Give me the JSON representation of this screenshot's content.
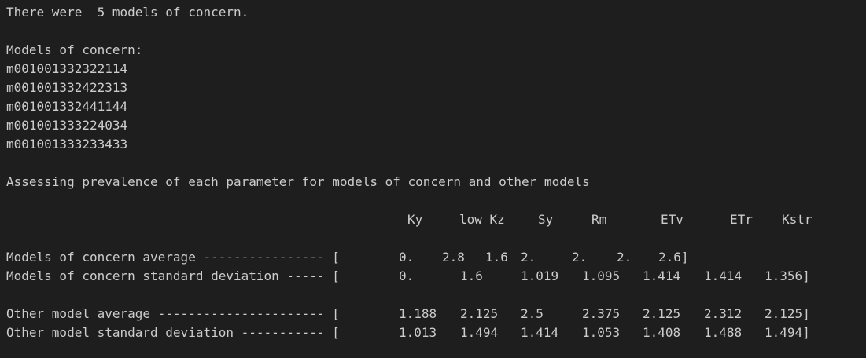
{
  "output": {
    "summary": "There were  5 models of concern.",
    "models_heading": "Models of concern:",
    "models": [
      "m001001332322114",
      "m001001332422313",
      "m001001332441144",
      "m001001333224034",
      "m001001333233433"
    ],
    "assessing": "Assessing prevalence of each parameter for models of concern and other models",
    "columns": [
      "Ky",
      "low Kz",
      "Sy",
      "Rm",
      "ETv",
      "ETr",
      "Kstr"
    ],
    "rows": [
      {
        "label": "Models of concern average ---------------- [",
        "values": [
          "0.",
          "2.8",
          "1.6",
          "2.",
          "2.",
          "2.",
          "2.6]"
        ]
      },
      {
        "label": "Models of concern standard deviation ----- [",
        "values": [
          "0.",
          "1.6",
          "1.019",
          "1.095",
          "1.414",
          "1.414",
          "1.356]"
        ]
      },
      {
        "label": "Other model average ---------------------- [",
        "values": [
          "1.188",
          "2.125",
          "2.5",
          "2.375",
          "2.125",
          "2.312",
          "2.125]"
        ]
      },
      {
        "label": "Other model standard deviation ----------- [",
        "values": [
          "1.013",
          "1.494",
          "1.414",
          "1.053",
          "1.408",
          "1.488",
          "1.494]"
        ]
      }
    ]
  }
}
